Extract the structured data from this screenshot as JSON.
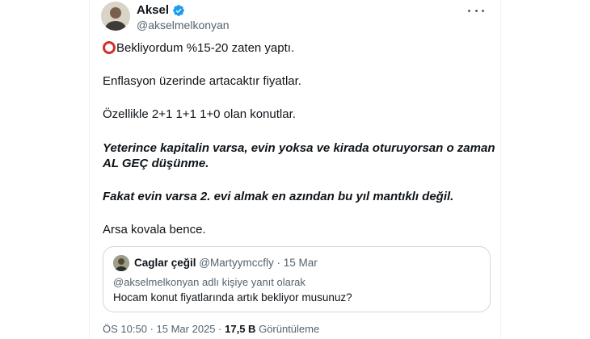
{
  "author": {
    "display_name": "Aksel",
    "handle": "@akselmelkonyan",
    "verified_icon": "verified-badge-icon",
    "badge_color": "#1d9bf0"
  },
  "tweet": {
    "lines": [
      "Bekliyordum %15-20 zaten yaptı.",
      "Enflasyon üzerinde artacaktır fiyatlar.",
      "Özellikle 2+1 1+1 1+0 olan konutlar.",
      "Yeterince kapitalin varsa, evin yoksa ve kirada oturuyorsan o zaman",
      "AL GEÇ düşünme.",
      "Fakat evin varsa 2. evi almak en azından bu yıl mantıklı değil.",
      "Arsa kovala bence."
    ],
    "leading_icon": "red-circle-icon"
  },
  "quote": {
    "display_name": "Caglar çeğil",
    "handle": "@Martyymccfly",
    "separator": "·",
    "date": "15 Mar",
    "reply_context": "@akselmelkonyan adlı kişiye yanıt olarak",
    "text": "Hocam konut fiyatlarında artık bekliyor musunuz?"
  },
  "meta": {
    "time": "ÖS 10:50",
    "separator": "·",
    "date": "15 Mar 2025",
    "views_count": "17,5 B",
    "views_label": "Görüntüleme"
  },
  "colors": {
    "text": "#0f1419",
    "secondary": "#536471",
    "border": "#cfd9de",
    "circle": "#d32f2f"
  }
}
